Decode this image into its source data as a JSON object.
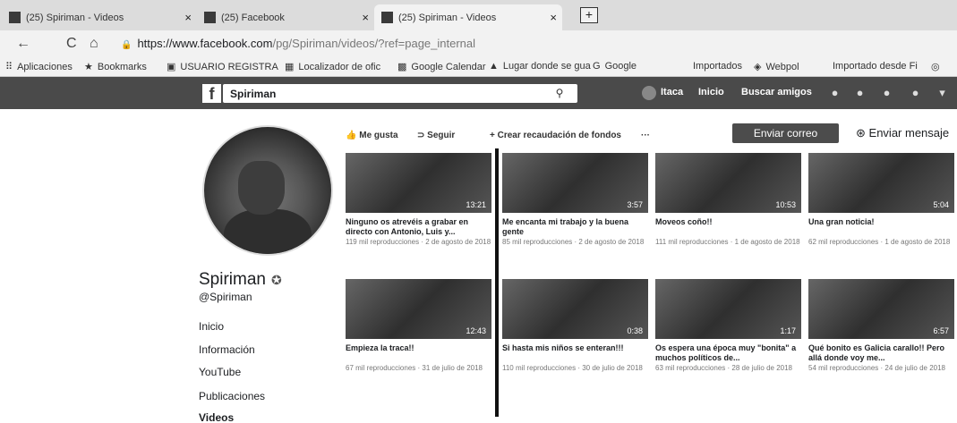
{
  "browser": {
    "tabs": [
      {
        "title": "(25) Spiriman - Videos",
        "close": "×"
      },
      {
        "title": "(25) Facebook",
        "close": "×"
      },
      {
        "title": "(25) Spiriman - Videos",
        "close": "×"
      }
    ],
    "new_tab": "+",
    "nav": {
      "back": "←",
      "forward": "C",
      "home": "⌂"
    },
    "url": {
      "host": "https://www.facebook.com",
      "path": "/pg/Spiriman/videos/?ref=page_internal"
    },
    "bookmarks": [
      {
        "label": "Aplicaciones",
        "icon": "apps-icon",
        "glyph": "⠿"
      },
      {
        "label": "Bookmarks",
        "icon": "star-icon",
        "glyph": "★"
      },
      {
        "label": "USUARIO REGISTRA",
        "icon": "page-icon",
        "glyph": "▣"
      },
      {
        "label": "Localizador de ofic",
        "icon": "map-icon",
        "glyph": "▦"
      },
      {
        "label": "Google Calendar",
        "icon": "calendar-icon",
        "glyph": "▩"
      },
      {
        "label": "Lugar donde se gua",
        "icon": "drive-icon",
        "glyph": "▲"
      },
      {
        "label": "Google",
        "icon": "google-icon",
        "glyph": "G"
      },
      {
        "label": "Importados",
        "icon": "folder-icon",
        "glyph": ""
      },
      {
        "label": "Webpol",
        "icon": "webpol-icon",
        "glyph": "◈"
      },
      {
        "label": "Importado desde Fi",
        "icon": "folder-icon",
        "glyph": ""
      },
      {
        "label": "",
        "icon": "extension-icon",
        "glyph": "◎"
      }
    ]
  },
  "facebook": {
    "logo": "f",
    "search_value": "Spiriman",
    "search_icon": "⚲",
    "nav": {
      "user": "Itaca",
      "home": "Inicio",
      "find_friends": "Buscar amigos"
    }
  },
  "profile": {
    "name": "Spiriman",
    "verified_glyph": "✪",
    "handle": "@Spiriman",
    "links": [
      "Inicio",
      "Información",
      "YouTube",
      "Publicaciones",
      "Videos"
    ]
  },
  "actions": {
    "like": "Me gusta",
    "like_icon": "👍",
    "follow": "Seguir",
    "follow_icon": "⊃",
    "fundraiser": "Crear recaudación de fondos",
    "fundraiser_icon": "+",
    "more": "···",
    "email": "Enviar correo",
    "message": "Enviar mensaje",
    "message_icon": "⊛"
  },
  "videos": [
    {
      "title": "Ninguno os atrevéis a grabar en directo con Antonio, Luis y...",
      "meta": "119 mil reproducciones · 2 de agosto de 2018",
      "duration": "13:21"
    },
    {
      "title": "Me encanta mi trabajo y la buena gente",
      "meta": "85 mil reproducciones · 2 de agosto de 2018",
      "duration": "3:57"
    },
    {
      "title": "Moveos coño!!",
      "meta": "111 mil reproducciones · 1 de agosto de 2018",
      "duration": "10:53"
    },
    {
      "title": "Una gran noticia!",
      "meta": "62 mil reproducciones · 1 de agosto de 2018",
      "duration": "5:04"
    },
    {
      "title": "Empieza la traca!!",
      "meta": "67 mil reproducciones · 31 de julio de 2018",
      "duration": "12:43"
    },
    {
      "title": "Si hasta mis niños se enteran!!!",
      "meta": "110 mil reproducciones · 30 de julio de 2018",
      "duration": "0:38"
    },
    {
      "title": "Os espera una época muy \"bonita\" a muchos políticos de...",
      "meta": "63 mil reproducciones · 28 de julio de 2018",
      "duration": "1:17"
    },
    {
      "title": "Qué bonito es Galicia carallo!! Pero allá donde voy me...",
      "meta": "54 mil reproducciones · 24 de julio de 2018",
      "duration": "6:57"
    }
  ]
}
